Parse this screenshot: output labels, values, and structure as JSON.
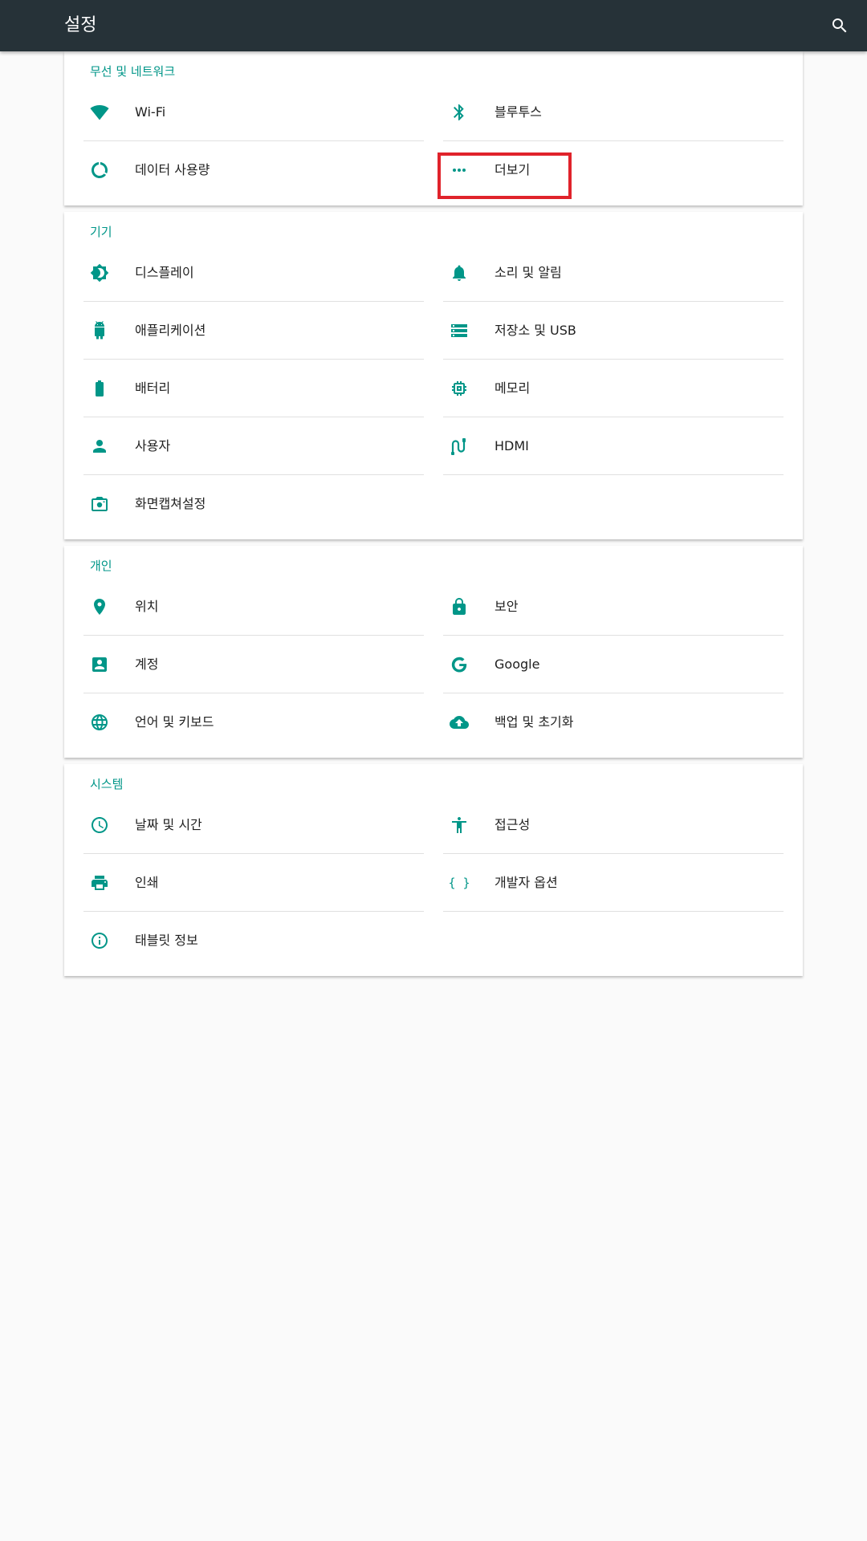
{
  "appbar": {
    "title": "설정",
    "search_icon": "search-icon"
  },
  "accent_color": "#009688",
  "sections": [
    {
      "category": "무선 및 네트워크",
      "items": [
        {
          "label": "Wi-Fi",
          "icon": "wifi-icon"
        },
        {
          "label": "블루투스",
          "icon": "bluetooth-icon"
        },
        {
          "label": "데이터 사용량",
          "icon": "data-usage-icon"
        },
        {
          "label": "더보기",
          "icon": "more-horiz-icon"
        }
      ]
    },
    {
      "category": "기기",
      "items": [
        {
          "label": "디스플레이",
          "icon": "brightness-icon"
        },
        {
          "label": "소리 및 알림",
          "icon": "bell-icon"
        },
        {
          "label": "애플리케이션",
          "icon": "android-icon"
        },
        {
          "label": "저장소 및 USB",
          "icon": "storage-icon"
        },
        {
          "label": "배터리",
          "icon": "battery-icon"
        },
        {
          "label": "메모리",
          "icon": "memory-icon"
        },
        {
          "label": "사용자",
          "icon": "person-icon"
        },
        {
          "label": "HDMI",
          "icon": "hdmi-cable-icon"
        },
        {
          "label": "화면캡쳐설정",
          "icon": "camera-icon"
        }
      ]
    },
    {
      "category": "개인",
      "items": [
        {
          "label": "위치",
          "icon": "location-pin-icon"
        },
        {
          "label": "보안",
          "icon": "lock-icon"
        },
        {
          "label": "계정",
          "icon": "account-box-icon"
        },
        {
          "label": "Google",
          "icon": "google-icon"
        },
        {
          "label": "언어 및 키보드",
          "icon": "globe-icon"
        },
        {
          "label": "백업 및 초기화",
          "icon": "cloud-upload-icon"
        }
      ]
    },
    {
      "category": "시스템",
      "items": [
        {
          "label": "날짜 및 시간",
          "icon": "clock-icon"
        },
        {
          "label": "접근성",
          "icon": "accessibility-icon"
        },
        {
          "label": "인쇄",
          "icon": "printer-icon"
        },
        {
          "label": "개발자 옵션",
          "icon": "code-braces-icon"
        },
        {
          "label": "태블릿 정보",
          "icon": "info-icon"
        }
      ]
    }
  ]
}
